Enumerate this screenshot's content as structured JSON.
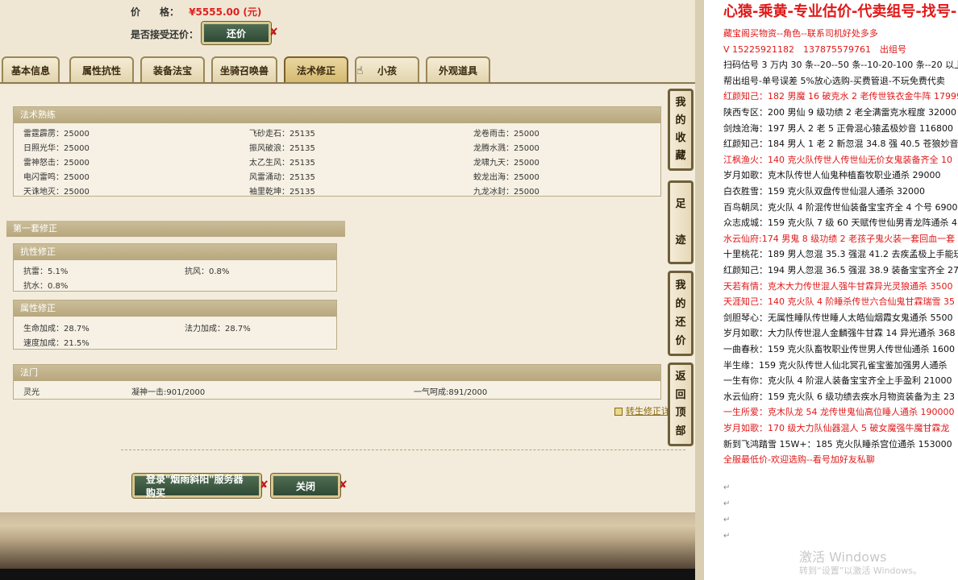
{
  "price": {
    "label": "价　　格：",
    "value": "¥5555.00 (元)"
  },
  "accept": {
    "label": "是否接受还价：",
    "button": "还价"
  },
  "tabs": [
    "基本信息",
    "属性抗性",
    "装备法宝",
    "坐骑召唤兽",
    "法术修正",
    "小孩",
    "外观道具"
  ],
  "skills": {
    "title": "法术熟练",
    "rows": [
      [
        "雷霆霹雳：25000",
        "飞砂走石：25135",
        "龙卷雨击：25000"
      ],
      [
        "日照光华：25000",
        "振风破浪：25135",
        "龙腾水溅：25000"
      ],
      [
        "雷神怒击：25000",
        "太乙生风：25135",
        "龙啸九天：25000"
      ],
      [
        "电闪雷鸣：25000",
        "风雷涌动：25135",
        "蛟龙出海：25000"
      ],
      [
        "天诛地灭：25000",
        "袖里乾坤：25135",
        "九龙冰封：25000"
      ]
    ]
  },
  "first_set": {
    "title": "第一套修正"
  },
  "resist": {
    "title": "抗性修正",
    "rows": [
      [
        "抗雷：5.1%",
        "抗风：0.8%"
      ],
      [
        "抗水：0.8%",
        ""
      ]
    ]
  },
  "attr": {
    "title": "属性修正",
    "rows": [
      [
        "生命加成：28.7%",
        "法力加成：28.7%"
      ],
      [
        "速度加成：21.5%",
        ""
      ]
    ]
  },
  "gate": {
    "title": "法门",
    "items": [
      "灵光",
      "凝神一击:901/2000",
      "一气呵成:891/2000"
    ]
  },
  "side_buttons": [
    [
      "我",
      "的",
      "收",
      "藏"
    ],
    [
      "足",
      "迹"
    ],
    [
      "我",
      "的",
      "还",
      "价"
    ],
    [
      "返",
      "回",
      "顶",
      "部"
    ]
  ],
  "transfer_link": "转生修正详",
  "bottom": {
    "login": "登录\"烟雨斜阳\"服务器购买",
    "close": "关闭"
  },
  "doc": {
    "title": "心猿-乘黄-专业估价-代卖组号-找号-",
    "lines": [
      {
        "text": "藏宝阁买物资--角色--联系司机好处多多",
        "red": true
      },
      {
        "text": "V 15225921182　137875579761　出组号",
        "red": true
      },
      {
        "text": "扫码估号 3 万内 30 条--20--50 条--10-20-100 条--20 以上",
        "red": false
      },
      {
        "text": "帮出组号-单号误差 5%放心选购-买费管退-不玩免费代卖",
        "red": false
      },
      {
        "text": "红颜知己：182 男魔 16 破克水 2 老传世铁衣金牛阵 17999",
        "red": true
      },
      {
        "text": "陕西专区：200 男仙 9 级功绩 2 老全满雷克水程度 32000",
        "red": false
      },
      {
        "text": "剑烛沧海：197 男人 2 老 5 正骨混心猿孟极妙音 116800",
        "red": false
      },
      {
        "text": "红颜知己：184 男人 1 老 2 新忽混 34.8 强 40.5 苍狼妙音 22",
        "red": false
      },
      {
        "text": "江枫渔火：140 克火队传世人传世仙无价女鬼装备齐全 10",
        "red": true
      },
      {
        "text": "岁月如歌：克木队传世人仙鬼种植畜牧职业通杀 29000",
        "red": false
      },
      {
        "text": "白衣胜雪：159 克火队双盘传世仙混人通杀 32000",
        "red": false
      },
      {
        "text": "百鸟朝凤：克火队 4 阶混传世仙装备宝宝齐全 4 个号 6900",
        "red": false
      },
      {
        "text": "众志成城：159 克火队 7 级 60 天赋传世仙男青龙阵通杀 45",
        "red": false
      },
      {
        "text": "水云仙府:174 男鬼 8 级功绩 2 老孩子鬼火装一套回血一套",
        "red": true
      },
      {
        "text": "十里桃花：189 男人忽混 35.3 强混 41.2 去疾孟极上手能玩",
        "red": false
      },
      {
        "text": "红颜知己：194 男人忽混 36.5 强混 38.9 装备宝宝齐全 2750",
        "red": false
      },
      {
        "text": "天若有情：克木大力传世混人强牛甘霖异光灵狼通杀 3500",
        "red": true
      },
      {
        "text": "天涯知己：140 克火队 4 阶睡杀传世六合仙鬼甘霖瑞雪 35",
        "red": true
      },
      {
        "text": "剑胆琴心：无属性睡队传世睡人太皓仙烟霞女鬼通杀 5500",
        "red": false
      },
      {
        "text": "岁月如歌：大力队传世混人金麟强牛甘霖 14 异光通杀 368",
        "red": false
      },
      {
        "text": "一曲春秋：159 克火队畜牧职业传世男人传世仙通杀 1600",
        "red": false
      },
      {
        "text": "半生缘：159 克火队传世人仙北冥孔雀宝鉴加强男人通杀",
        "red": false
      },
      {
        "text": "一生有你：克火队 4 阶混人装备宝宝齐全上手盈利 21000",
        "red": false
      },
      {
        "text": "水云仙府：159 克火队 6 级功绩去疾水月物资装备为主 23",
        "red": false
      },
      {
        "text": "一生所爱：克木队龙 54 龙传世鬼仙高位睡人通杀 190000",
        "red": true
      },
      {
        "text": "岁月如歌：170 级大力队仙器混人 5 破女魔强牛魔甘霖龙",
        "red": true
      },
      {
        "text": "新到飞鸿踏雪 15W+：185 克火队睡杀宫位通杀 153000",
        "red": false
      },
      {
        "text": "全服最低价-欢迎选购--看号加好友私聊",
        "red": true
      }
    ],
    "watermark": "激活 Windows",
    "watermark_sub": "转到“设置”以激活 Windows。"
  }
}
